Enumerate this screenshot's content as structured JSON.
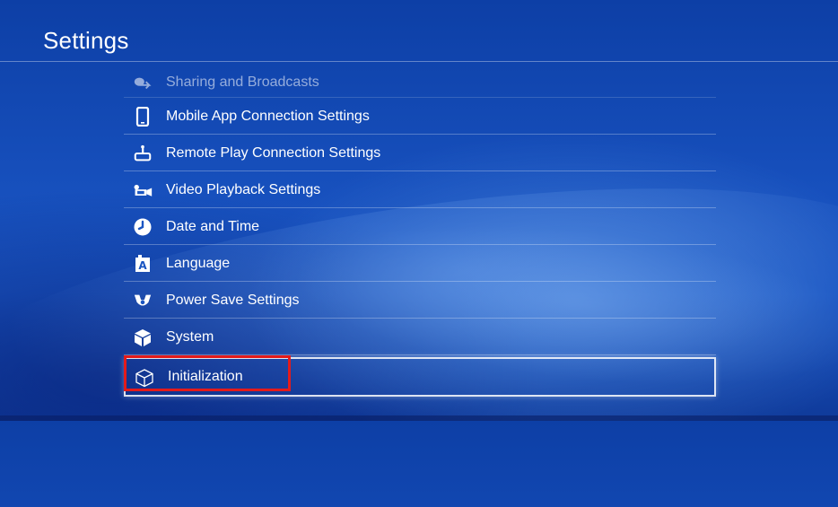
{
  "header": {
    "title": "Settings"
  },
  "menu": {
    "items": [
      {
        "label": "Sharing and Broadcasts",
        "icon": "share-icon"
      },
      {
        "label": "Mobile App Connection Settings",
        "icon": "mobile-phone-icon"
      },
      {
        "label": "Remote Play Connection Settings",
        "icon": "remote-play-icon"
      },
      {
        "label": "Video Playback Settings",
        "icon": "video-camera-icon"
      },
      {
        "label": "Date and Time",
        "icon": "clock-icon"
      },
      {
        "label": "Language",
        "icon": "language-icon"
      },
      {
        "label": "Power Save Settings",
        "icon": "power-save-icon"
      },
      {
        "label": "System",
        "icon": "system-cube-icon"
      },
      {
        "label": "Initialization",
        "icon": "initialization-cube-icon"
      }
    ],
    "selected_index": 8
  },
  "colors": {
    "background": "#1750bd",
    "text": "#ffffff",
    "highlight_box": "#e31b1b"
  }
}
